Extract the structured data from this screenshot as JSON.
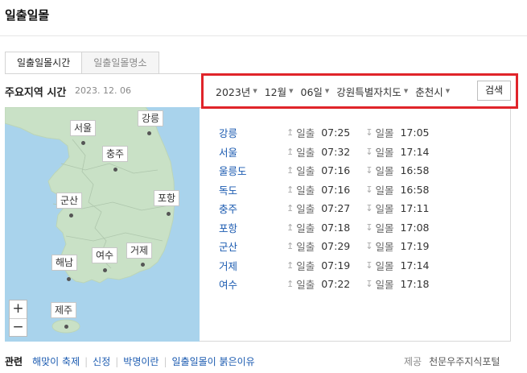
{
  "header": {
    "title": "일출일몰"
  },
  "tabs": [
    {
      "label": "일출일몰시간",
      "active": true
    },
    {
      "label": "일출일몰명소",
      "active": false
    }
  ],
  "region": {
    "title": "주요지역 시간",
    "date": "2023. 12. 06"
  },
  "filters": {
    "year": "2023년",
    "month": "12월",
    "day": "06일",
    "province": "강원특별자치도",
    "city": "춘천시",
    "search_label": "검색",
    "highlight_color": "#e0242a"
  },
  "map": {
    "cities": [
      "서울",
      "강릉",
      "충주",
      "군산",
      "포항",
      "여수",
      "거제",
      "해남",
      "제주"
    ],
    "zoom_in": "+",
    "zoom_out": "−"
  },
  "times": {
    "sunrise_label": "일출",
    "sunset_label": "일몰",
    "sunrise_icon": "↥",
    "sunset_icon": "↧",
    "rows": [
      {
        "city": "강릉",
        "sunrise": "07:25",
        "sunset": "17:05"
      },
      {
        "city": "서울",
        "sunrise": "07:32",
        "sunset": "17:14"
      },
      {
        "city": "울릉도",
        "sunrise": "07:16",
        "sunset": "16:58"
      },
      {
        "city": "독도",
        "sunrise": "07:16",
        "sunset": "16:58"
      },
      {
        "city": "충주",
        "sunrise": "07:27",
        "sunset": "17:11"
      },
      {
        "city": "포항",
        "sunrise": "07:18",
        "sunset": "17:08"
      },
      {
        "city": "군산",
        "sunrise": "07:29",
        "sunset": "17:19"
      },
      {
        "city": "거제",
        "sunrise": "07:19",
        "sunset": "17:14"
      },
      {
        "city": "여수",
        "sunrise": "07:22",
        "sunset": "17:18"
      }
    ]
  },
  "related": {
    "heading": "관련",
    "links": [
      "해맞이 축제",
      "신정",
      "박명이란",
      "일출일몰이 붉은이유"
    ]
  },
  "provider": {
    "label": "제공",
    "value": "천문우주지식포털"
  }
}
